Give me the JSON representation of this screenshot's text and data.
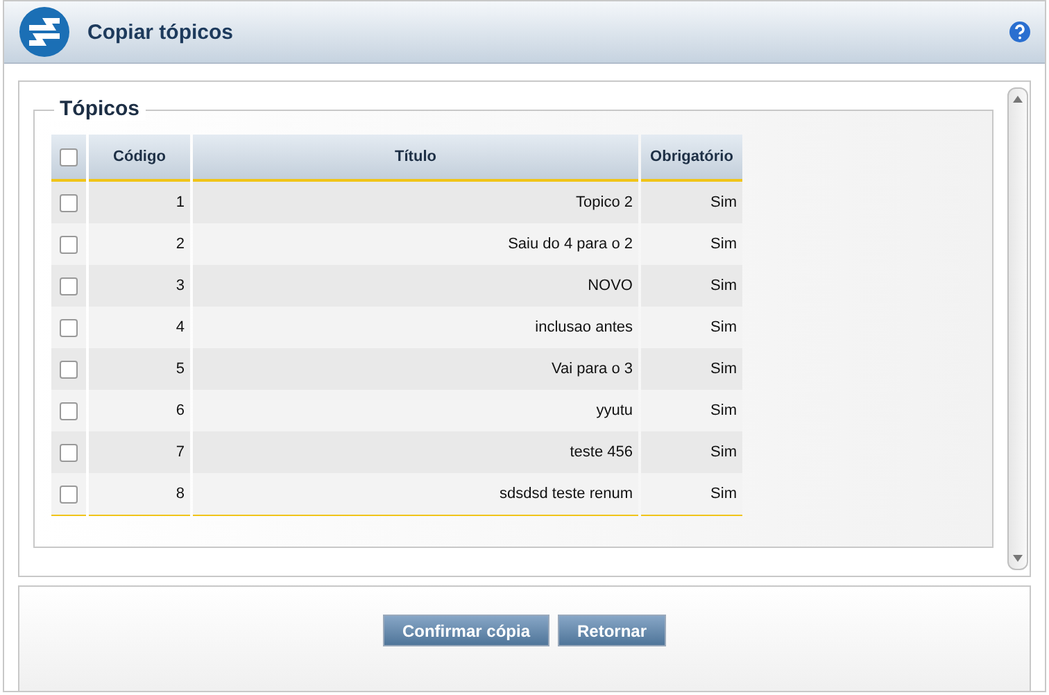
{
  "dialog": {
    "title": "Copiar tópicos"
  },
  "section": {
    "title": "Tópicos"
  },
  "table": {
    "select_all": {
      "checked": false
    },
    "columns": [
      "Código",
      "Título",
      "Obrigatório"
    ],
    "rows": [
      {
        "checked": false,
        "cells": [
          "1",
          "Topico 2",
          "Sim"
        ]
      },
      {
        "checked": false,
        "cells": [
          "2",
          "Saiu do 4 para o 2",
          "Sim"
        ]
      },
      {
        "checked": false,
        "cells": [
          "3",
          "NOVO",
          "Sim"
        ]
      },
      {
        "checked": false,
        "cells": [
          "4",
          "inclusao antes",
          "Sim"
        ]
      },
      {
        "checked": false,
        "cells": [
          "5",
          "Vai para o 3",
          "Sim"
        ]
      },
      {
        "checked": false,
        "cells": [
          "6",
          "yyutu",
          "Sim"
        ]
      },
      {
        "checked": false,
        "cells": [
          "7",
          "teste 456",
          "Sim"
        ]
      },
      {
        "checked": false,
        "cells": [
          "8",
          "sdsdsd teste renum",
          "Sim"
        ]
      }
    ]
  },
  "buttons": [
    "Confirmar cópia",
    "Retornar"
  ]
}
